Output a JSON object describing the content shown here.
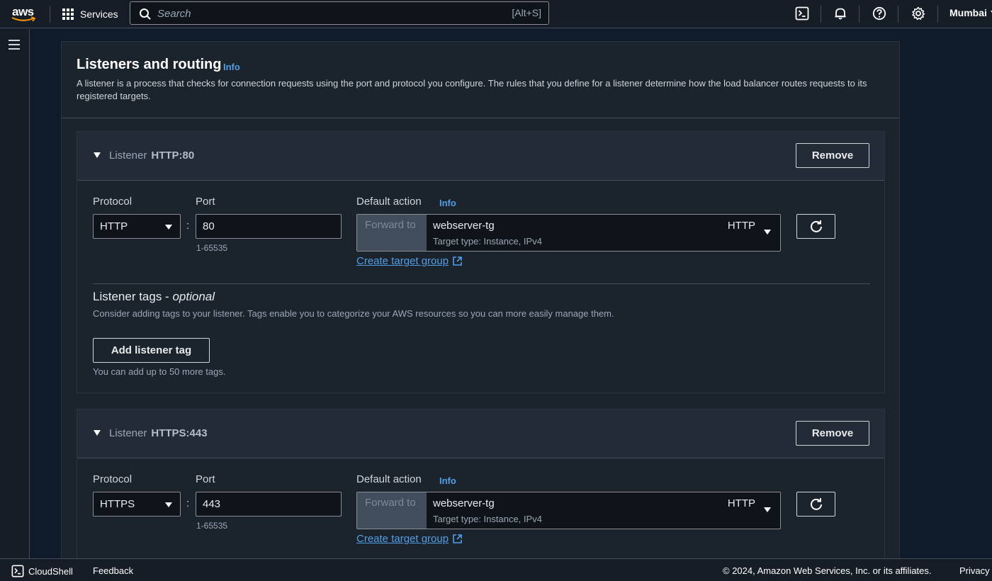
{
  "nav": {
    "logo": "aws",
    "services": "Services",
    "search_placeholder": "Search",
    "search_shortcut": "[Alt+S]",
    "region": "Mumbai",
    "icons": [
      "cloudshell-icon",
      "bell-icon",
      "help-icon",
      "gear-icon"
    ]
  },
  "section": {
    "title": "Listeners and routing",
    "info": "Info",
    "description": "A listener is a process that checks for connection requests using the port and protocol you configure. The rules that you define for a listener determine how the load balancer routes requests to its registered targets."
  },
  "listeners": [
    {
      "label": "Listener",
      "name": "HTTP:80",
      "remove": "Remove",
      "protocol_label": "Protocol",
      "protocol": "HTTP",
      "port_label": "Port",
      "port": "80",
      "port_hint": "1-65535",
      "default_action_label": "Default action",
      "info": "Info",
      "forward_to": "Forward to",
      "target_group": "webserver-tg",
      "target_type": "Target type: Instance, IPv4",
      "target_protocol": "HTTP",
      "create_target_group": "Create target group"
    },
    {
      "label": "Listener",
      "name": "HTTPS:443",
      "remove": "Remove",
      "protocol_label": "Protocol",
      "protocol": "HTTPS",
      "port_label": "Port",
      "port": "443",
      "port_hint": "1-65535",
      "default_action_label": "Default action",
      "info": "Info",
      "forward_to": "Forward to",
      "target_group": "webserver-tg",
      "target_type": "Target type: Instance, IPv4",
      "target_protocol": "HTTP",
      "create_target_group": "Create target group"
    }
  ],
  "tags": {
    "title": "Listener tags - ",
    "title_optional": "optional",
    "description": "Consider adding tags to your listener. Tags enable you to categorize your AWS resources so you can more easily manage them.",
    "add_button": "Add listener tag",
    "hint": "You can add up to 50 more tags."
  },
  "footer": {
    "cloudshell": "CloudShell",
    "feedback": "Feedback",
    "copyright": "© 2024, Amazon Web Services, Inc. or its affiliates.",
    "privacy": "Privacy"
  }
}
